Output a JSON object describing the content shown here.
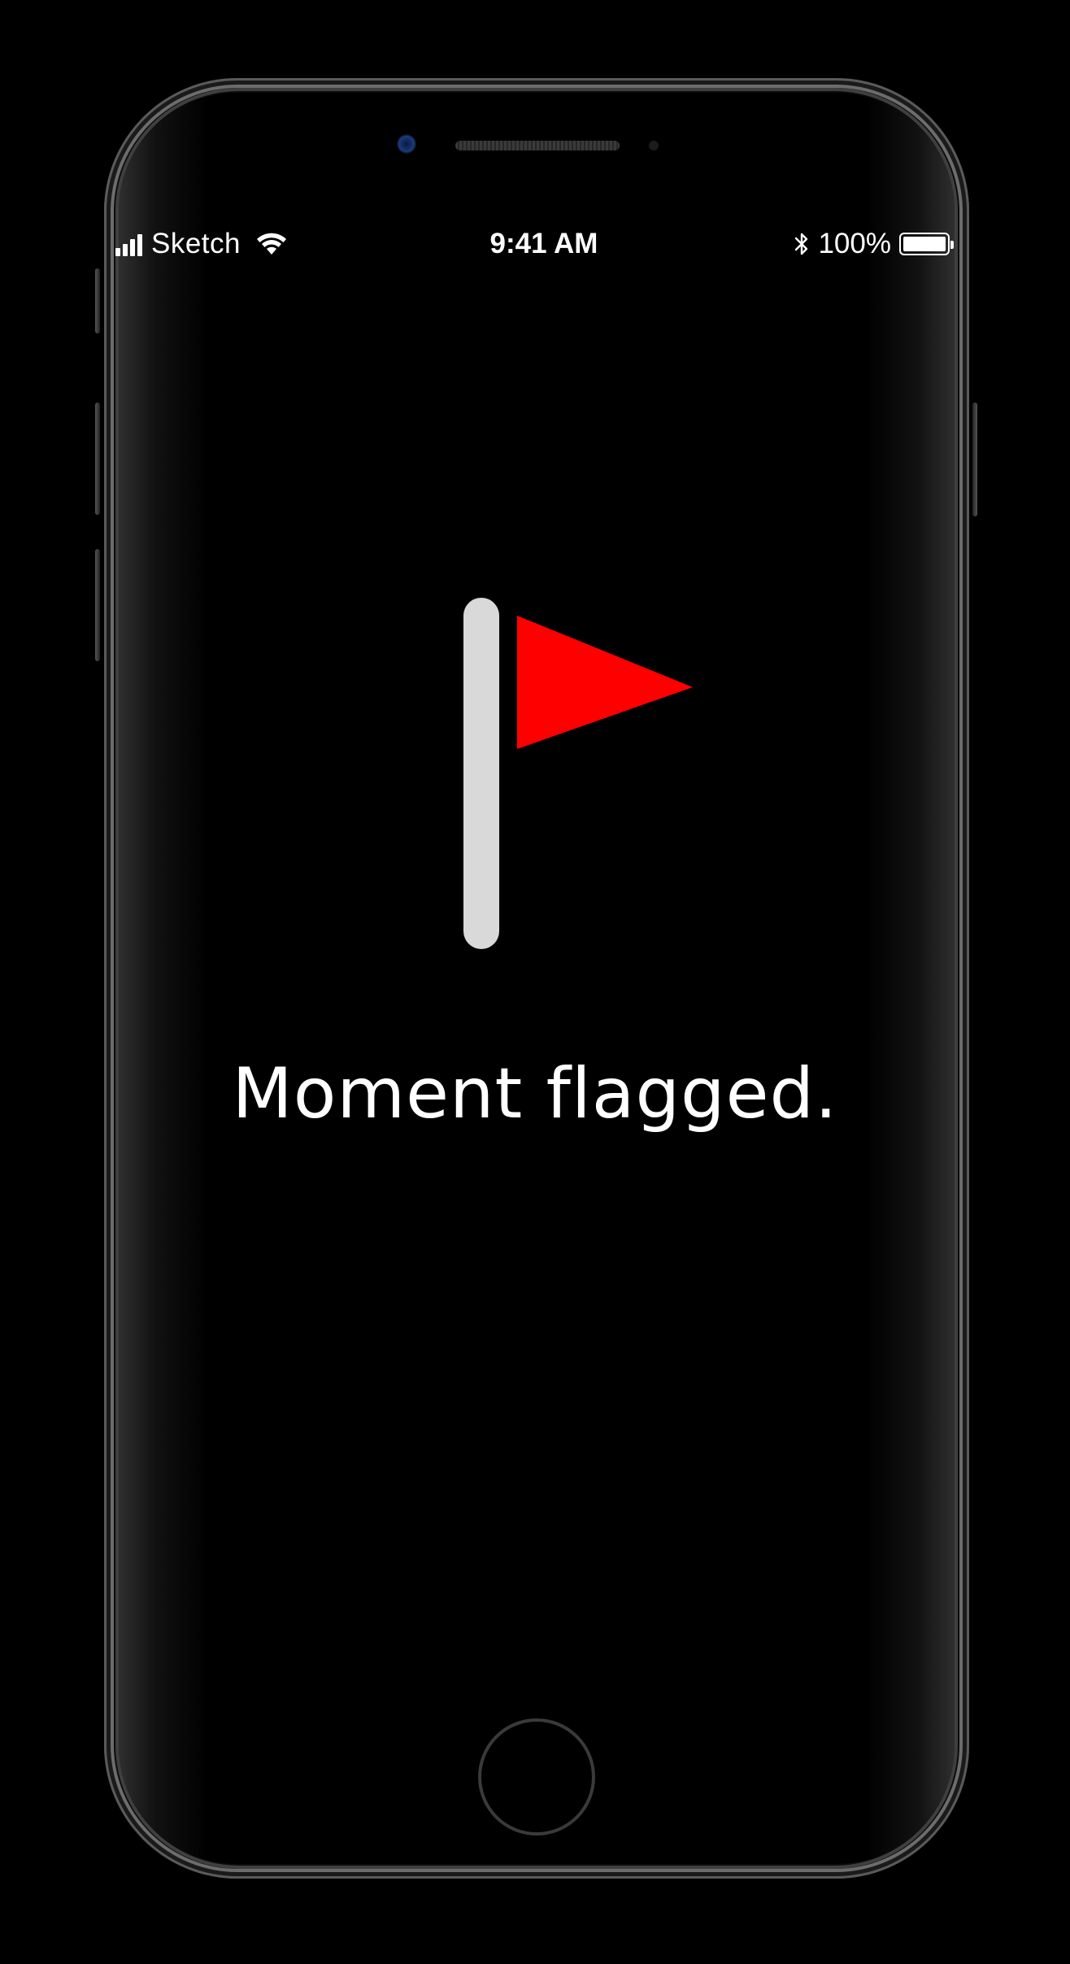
{
  "status_bar": {
    "carrier": "Sketch",
    "time": "9:41 AM",
    "battery_percent": "100%",
    "battery_level": 1.0,
    "signal_bars": 4,
    "icons": [
      "signal-icon",
      "wifi-icon",
      "bluetooth-icon",
      "battery-icon"
    ]
  },
  "main": {
    "icon": "flag-icon",
    "message": "Moment flagged."
  },
  "colors": {
    "background": "#000000",
    "flag_pole": "#d9d9d9",
    "flag": "#ff0000",
    "text": "#ffffff"
  }
}
